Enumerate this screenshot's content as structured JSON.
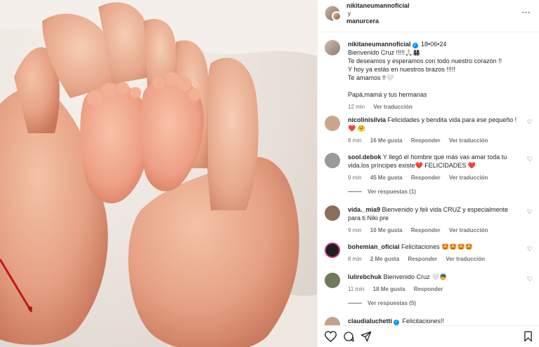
{
  "header": {
    "user1": "nikitaneumannoficial",
    "and": "y",
    "user2": "manurcera",
    "more_icon": "⋯"
  },
  "caption": {
    "username": "nikitaneumannoficial",
    "date": "18•06•24",
    "lines": [
      "Bienvenido Cruz !!!!!🙏🏻👨‍👩‍👧‍👦",
      "Te deseamos y esperamos con todo nuestro corazón !!",
      "Y hoy ya estás en nuestros brazos !!!!!",
      "Te amamos !!🤍",
      "",
      "Papá,mamá y tus hermanas"
    ],
    "time": "12 min",
    "translate": "Ver traducción"
  },
  "comments": [
    {
      "username": "nicolinisilvia",
      "text": "Felicidades y bendita vida para ese pequeño ! ❤️ 🤗",
      "time": "8 min",
      "likes": "16 Me gusta",
      "reply": "Responder",
      "translate": "Ver traducción",
      "avatar_color": "#caa78c"
    },
    {
      "username": "sool.debok",
      "text": "Y llegó el hombre que más vas amar toda tu vida.los príncipes existe❤️ FELICIDADES ❤️",
      "time": "9 min",
      "likes": "45 Me gusta",
      "reply": "Responder",
      "translate": "Ver traducción",
      "replies": "Ver respuestas (1)",
      "avatar_color": "#9a9a9a"
    },
    {
      "username": "vida._mia9",
      "text": "Bienvenido y feli vida CRUZ y especialmente para ti Niki pre",
      "time": "9 min",
      "likes": "10 Me gusta",
      "reply": "Responder",
      "translate": "Ver traducción",
      "avatar_color": "#8c6e5d"
    },
    {
      "username": "bohemian_oficial",
      "text": "Felicitaciones 🤩🤩🤩🤩",
      "time": "8 min",
      "likes": "2 Me gusta",
      "reply": "Responder",
      "translate": "Ver traducción",
      "avatar_color": "#1f1f1f"
    },
    {
      "username": "lulirebchuk",
      "text": "Bienvenido Cruz 🤍👼",
      "time": "11 min",
      "likes": "18 Me gusta",
      "reply": "Responder",
      "replies": "Ver respuestas (5)",
      "avatar_color": "#6f7a5a"
    },
    {
      "username": "claudialuchetti",
      "text": "Felicitaciones!!",
      "avatar_color": "#c8a08a"
    }
  ],
  "actions": {
    "like_icon": "heart-icon",
    "comment_icon": "comment-icon",
    "share_icon": "share-icon",
    "save_icon": "bookmark-icon"
  },
  "colors": {
    "verified": "#0095f6",
    "text": "#262626",
    "muted": "#737373",
    "heart_red": "#e0245e"
  }
}
